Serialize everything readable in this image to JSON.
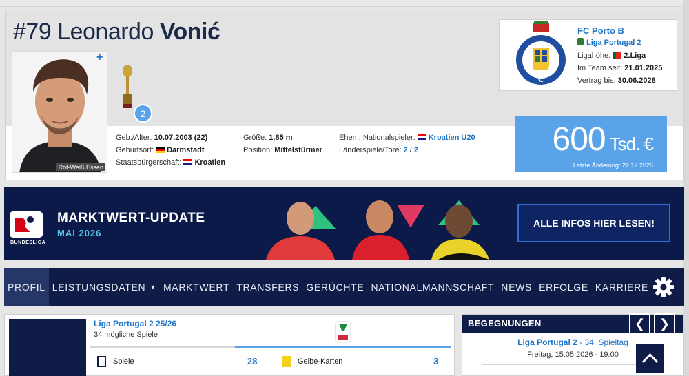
{
  "player": {
    "number": "#79",
    "first_name": "Leonardo",
    "last_name": "Vonić",
    "photo_caption": "Rot-Weiß Essen",
    "photo_plus": "+",
    "trophy_count": "2"
  },
  "info": {
    "dob_label": "Geb./Alter:",
    "dob_value": "10.07.2003 (22)",
    "birthplace_label": "Geburtsort:",
    "birthplace_value": "Darmstadt",
    "citizenship_label": "Staatsbürgerschaft:",
    "citizenship_value": "Kroatien",
    "height_label": "Größe:",
    "height_value": "1,85 m",
    "position_label": "Position:",
    "position_value": "Mittelstürmer",
    "former_nt_label": "Ehem. Nationalspieler:",
    "former_nt_value": "Kroatien U20",
    "caps_label": "Länderspiele/Tore:",
    "caps_value": "2",
    "caps_sep": "/",
    "goals_value": "2"
  },
  "club": {
    "name": "FC Porto B",
    "league": "Liga Portugal 2",
    "level_label": "Ligahöhe:",
    "level_value": "2.Liga",
    "since_label": "Im Team seit:",
    "since_value": "21.01.2025",
    "contract_label": "Vertrag bis:",
    "contract_value": "30.06.2028"
  },
  "market_value": {
    "value": "600",
    "unit": "Tsd. €",
    "last_change": "Letzte Änderung: 22.12.2025"
  },
  "banner": {
    "logo_label": "BUNDESLIGA",
    "title": "MARKTWERT-UPDATE",
    "subtitle": "MAI 2026",
    "button": "ALLE INFOS HIER LESEN!"
  },
  "nav": {
    "items": [
      "PROFIL",
      "LEISTUNGSDATEN",
      "MARKTWERT",
      "TRANSFERS",
      "GERÜCHTE",
      "NATIONALMANNSCHAFT",
      "NEWS",
      "ERFOLGE",
      "KARRIERE"
    ],
    "caret": "▼"
  },
  "stats": {
    "league": "Liga Portugal 2 25/26",
    "possible_games": "34 mögliche Spiele",
    "games_label": "Spiele",
    "games_value": "28",
    "yellow_label": "Gelbe-Karten",
    "yellow_value": "3"
  },
  "matches": {
    "title": "BEGEGNUNGEN",
    "prev": "❮",
    "next": "❯",
    "league": "Liga Portugal 2",
    "matchday": " - 34. Spieltag",
    "date": "Freitag, 15.05.2026 - 19:00"
  },
  "colors": {
    "navy": "#0f1c48",
    "accent_blue": "#5ba3e8",
    "link_blue": "#1d75c9"
  }
}
